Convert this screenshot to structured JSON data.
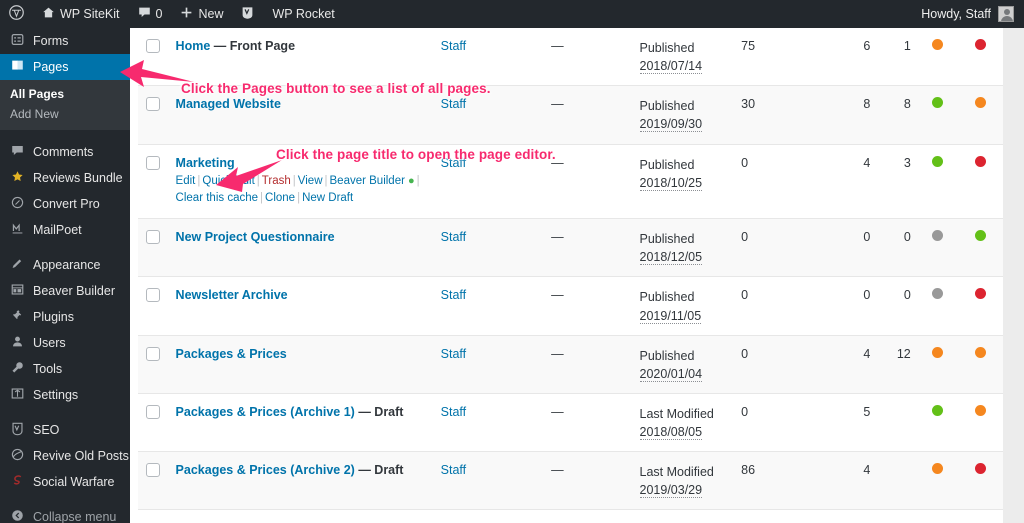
{
  "colors": {
    "admin_dark": "#23282d",
    "accent_blue": "#0073aa",
    "annotation_pink": "#f72a6e",
    "dot_orange": "#f5871f",
    "dot_red": "#dc2430",
    "dot_green": "#63c018",
    "dot_gray": "#999999"
  },
  "adminbar": {
    "logo": "wordpress-logo-icon",
    "items": [
      {
        "icon": "home-icon",
        "label": "WP SiteKit"
      },
      {
        "icon": "comment-icon",
        "label": "0"
      },
      {
        "icon": "plus-icon",
        "label": "New"
      },
      {
        "icon": "yoast-icon",
        "label": ""
      },
      {
        "icon": "rocket-icon",
        "label": "WP Rocket"
      }
    ],
    "greeting": "Howdy, Staff",
    "avatar": "user-avatar"
  },
  "sidebar": {
    "items": [
      {
        "icon": "forms-icon",
        "label": "Forms",
        "current": false
      },
      {
        "icon": "pages-icon",
        "label": "Pages",
        "current": true
      }
    ],
    "submenu": [
      {
        "label": "All Pages",
        "current": true
      },
      {
        "label": "Add New",
        "current": false
      }
    ],
    "group2": [
      {
        "icon": "comments-icon",
        "label": "Comments"
      },
      {
        "icon": "star-icon",
        "label": "Reviews Bundle"
      },
      {
        "icon": "compass-icon",
        "label": "Convert Pro"
      },
      {
        "icon": "mailpoet-icon",
        "label": "MailPoet"
      }
    ],
    "group3": [
      {
        "icon": "appearance-icon",
        "label": "Appearance"
      },
      {
        "icon": "beaver-builder-icon",
        "label": "Beaver Builder"
      },
      {
        "icon": "plugins-icon",
        "label": "Plugins"
      },
      {
        "icon": "users-icon",
        "label": "Users"
      },
      {
        "icon": "tools-icon",
        "label": "Tools"
      },
      {
        "icon": "settings-icon",
        "label": "Settings"
      }
    ],
    "group4": [
      {
        "icon": "yoast-seo-icon",
        "label": "SEO"
      },
      {
        "icon": "revive-old-posts-icon",
        "label": "Revive Old Posts"
      },
      {
        "icon": "social-warfare-icon",
        "label": "Social Warfare"
      }
    ],
    "collapse": {
      "icon": "collapse-icon",
      "label": "Collapse menu"
    }
  },
  "annotations": [
    {
      "id": "pages-button",
      "text": "Click the Pages button to see a list of all pages."
    },
    {
      "id": "page-title",
      "text": "Click the page title to open the page editor."
    }
  ],
  "table": {
    "rows": [
      {
        "title": "Home",
        "suffix": "— Front Page",
        "author": "Staff",
        "dash": "—",
        "date_label": "Published",
        "date_value": "2018/07/14",
        "count": "75",
        "n2": "6",
        "n3": "1",
        "dot1": "orange",
        "dot2": "red",
        "actions": false
      },
      {
        "title": "Managed Website",
        "suffix": "",
        "author": "Staff",
        "dash": "—",
        "date_label": "Published",
        "date_value": "2019/09/30",
        "count": "30",
        "n2": "8",
        "n3": "8",
        "dot1": "green",
        "dot2": "orange",
        "actions": false
      },
      {
        "title": "Marketing",
        "suffix": "",
        "author": "Staff",
        "dash": "—",
        "date_label": "Published",
        "date_value": "2018/10/25",
        "count": "0",
        "n2": "4",
        "n3": "3",
        "dot1": "green",
        "dot2": "red",
        "actions": true
      },
      {
        "title": "New Project Questionnaire",
        "suffix": "",
        "author": "Staff",
        "dash": "—",
        "date_label": "Published",
        "date_value": "2018/12/05",
        "count": "0",
        "n2": "0",
        "n3": "0",
        "dot1": "gray",
        "dot2": "green",
        "actions": false
      },
      {
        "title": "Newsletter Archive",
        "suffix": "",
        "author": "Staff",
        "dash": "—",
        "date_label": "Published",
        "date_value": "2019/11/05",
        "count": "0",
        "n2": "0",
        "n3": "0",
        "dot1": "gray",
        "dot2": "red",
        "actions": false
      },
      {
        "title": "Packages & Prices",
        "suffix": "",
        "author": "Staff",
        "dash": "—",
        "date_label": "Published",
        "date_value": "2020/01/04",
        "count": "0",
        "n2": "4",
        "n3": "12",
        "dot1": "orange",
        "dot2": "orange",
        "actions": false
      },
      {
        "title": "Packages & Prices (Archive 1)",
        "suffix": "— Draft",
        "author": "Staff",
        "dash": "—",
        "date_label": "Last Modified",
        "date_value": "2018/08/05",
        "count": "0",
        "n2": "5",
        "n3": "",
        "dot1": "green",
        "dot2": "orange",
        "actions": false
      },
      {
        "title": "Packages & Prices (Archive 2)",
        "suffix": "— Draft",
        "author": "Staff",
        "dash": "—",
        "date_label": "Last Modified",
        "date_value": "2019/03/29",
        "count": "86",
        "n2": "4",
        "n3": "",
        "dot1": "orange",
        "dot2": "red",
        "actions": false
      }
    ],
    "row_actions": {
      "edit": "Edit",
      "quick_edit": "Quick Edit",
      "trash": "Trash",
      "view": "View",
      "beaver_builder": "Beaver Builder",
      "clear_cache": "Clear this cache",
      "clone": "Clone",
      "new_draft": "New Draft"
    }
  }
}
